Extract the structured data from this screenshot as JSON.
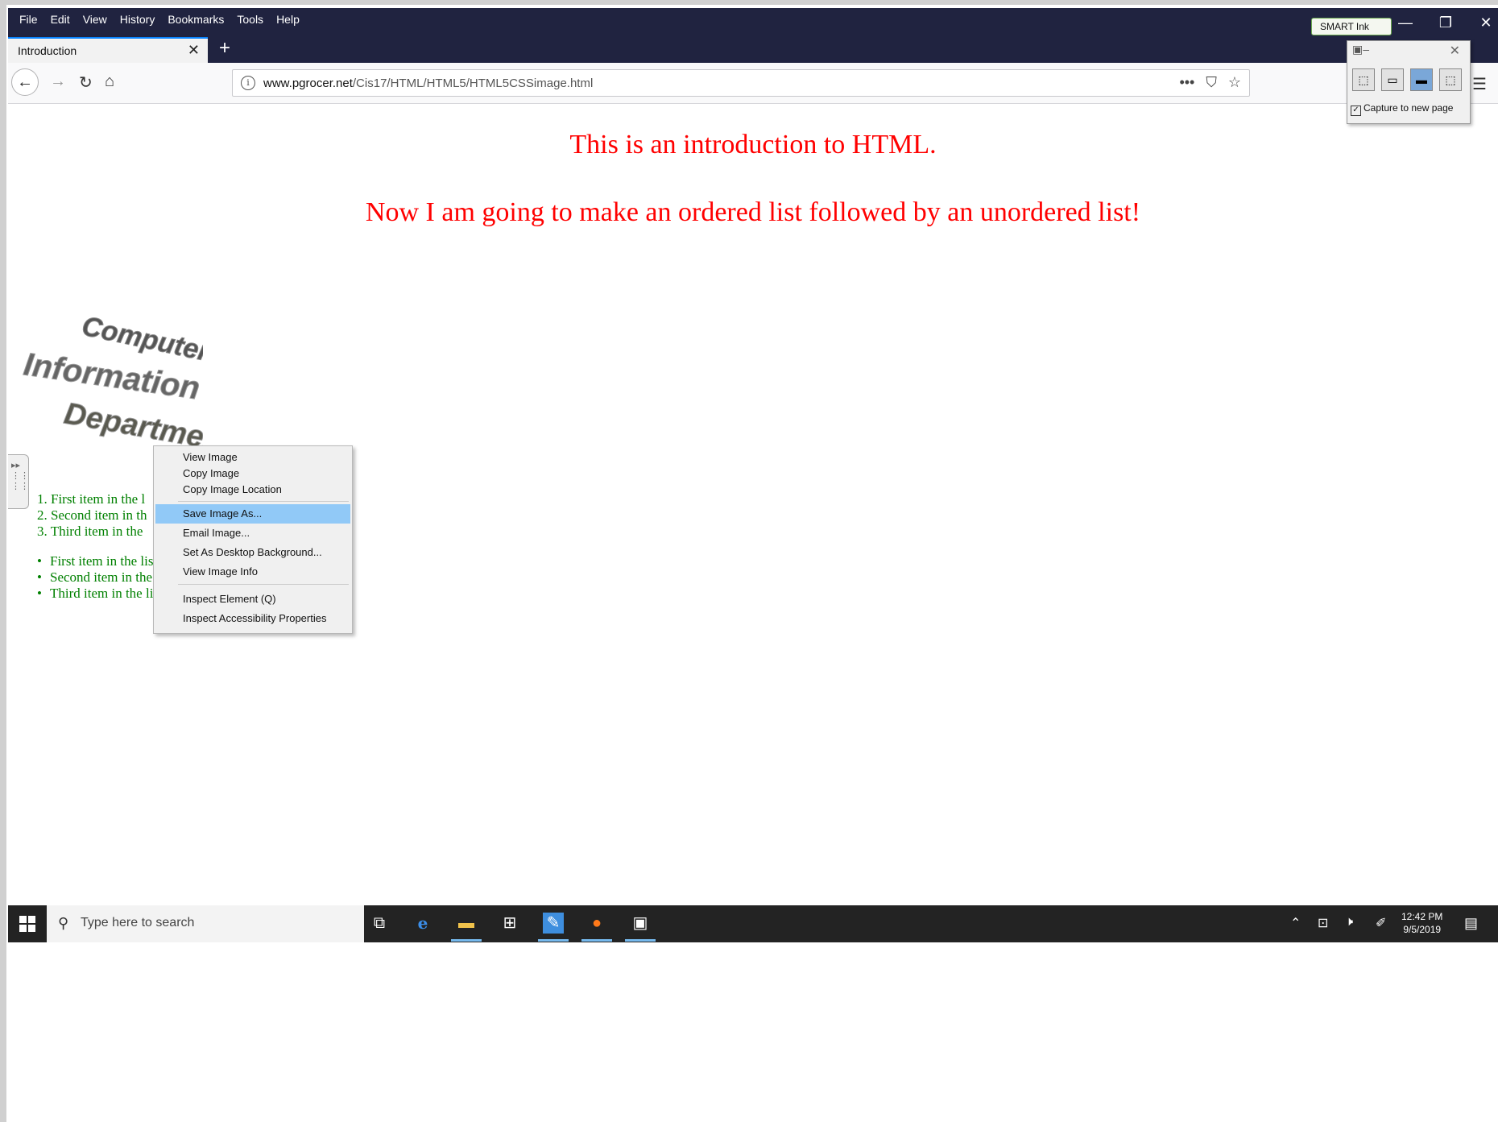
{
  "menubar": [
    "File",
    "Edit",
    "View",
    "History",
    "Bookmarks",
    "Tools",
    "Help"
  ],
  "tab": {
    "title": "Introduction",
    "close": "✕"
  },
  "newtab": "+",
  "window_controls": {
    "minimize": "—",
    "restore": "❐",
    "close": "✕"
  },
  "nav": {
    "back": "←",
    "forward": "→",
    "reload": "↻",
    "home": "⌂"
  },
  "url": {
    "host": "www.pgrocer.net",
    "path": "/Cis17/HTML/HTML5/HTML5CSSimage.html",
    "info": "i",
    "more": "•••",
    "pocket": "⛉",
    "bookmark": "☆"
  },
  "hamburger": "☰",
  "page": {
    "heading1": "This is an introduction to HTML.",
    "heading2": "Now I am going to make an ordered list followed by an unordered list!",
    "logo_words": [
      "Computer",
      "Information",
      "Department"
    ],
    "ordered_list": [
      "1. First item in the l",
      "2. Second item in th",
      "3. Third item in the"
    ],
    "unordered_list": [
      "First item in the list",
      "Second item in the list",
      "Third item in the list"
    ]
  },
  "context_menu": {
    "items": [
      "View Image",
      "Copy Image",
      "Copy Image Location",
      "Save Image As...",
      "Email Image...",
      "Set As Desktop Background...",
      "View Image Info",
      "Inspect Element (Q)",
      "Inspect Accessibility Properties"
    ],
    "highlighted": "Save Image As..."
  },
  "taskbar": {
    "search_placeholder": "Type here to search",
    "time": "12:42 PM",
    "date": "9/5/2019"
  },
  "smart_ink": {
    "label": "SMART Ink",
    "capture_checkbox": "Capture to new page",
    "checked": "✓"
  },
  "colors": {
    "accent": "#0a84ff",
    "heading": "#ff0000",
    "list": "#008000",
    "menu_highlight": "#91c9f7",
    "titlebar": "#202340"
  }
}
